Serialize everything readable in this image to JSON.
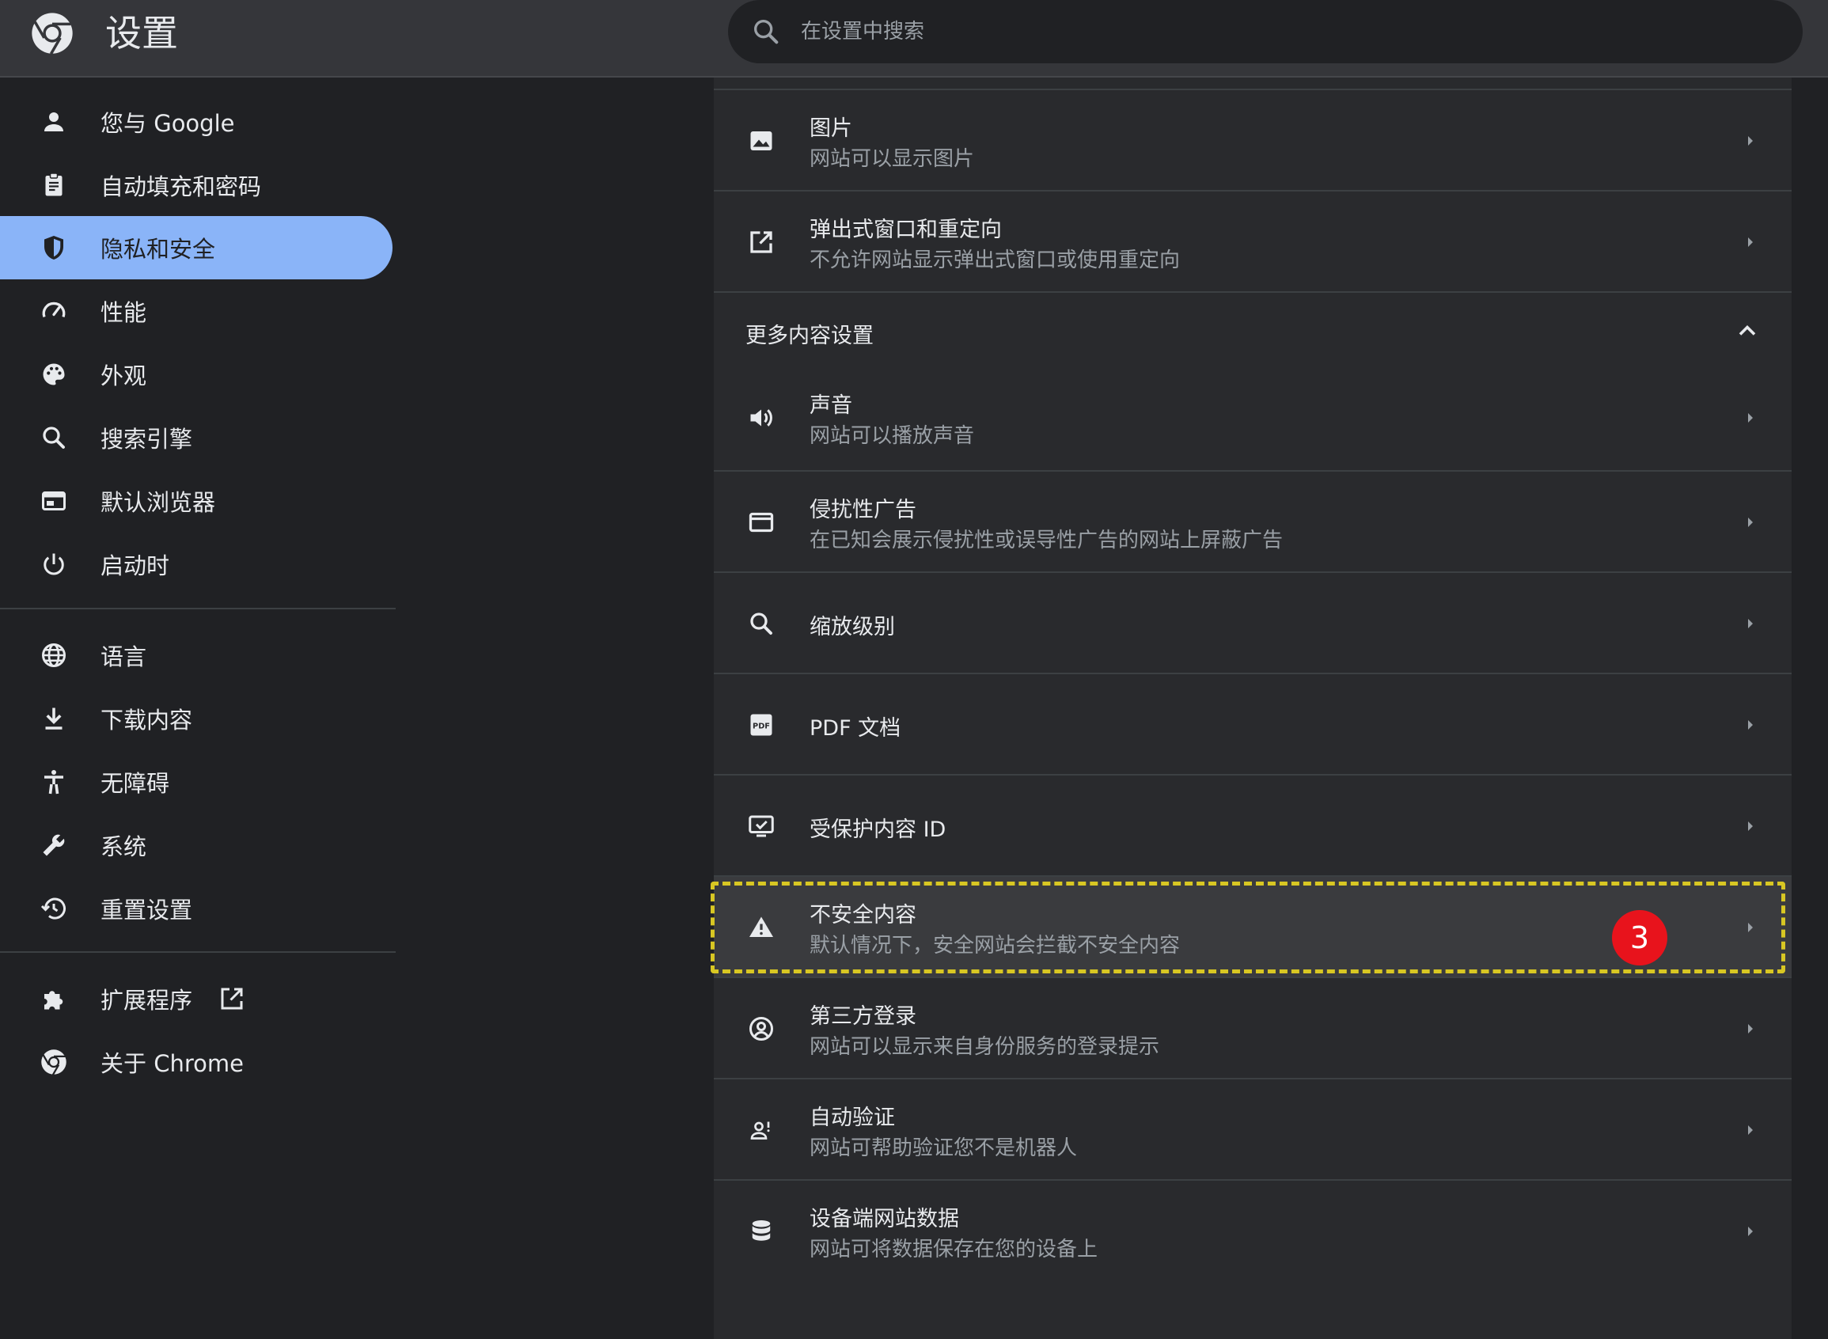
{
  "header": {
    "title": "设置",
    "search_placeholder": "在设置中搜索",
    "icons": {
      "logo": "chrome-logo-icon",
      "search": "search-icon"
    }
  },
  "sidebar": {
    "items": [
      {
        "label": "您与 Google",
        "icon": "person-icon",
        "active": false
      },
      {
        "label": "自动填充和密码",
        "icon": "clipboard-icon",
        "active": false
      },
      {
        "label": "隐私和安全",
        "icon": "shield-icon",
        "active": true
      },
      {
        "label": "性能",
        "icon": "speedometer-icon",
        "active": false
      },
      {
        "label": "外观",
        "icon": "palette-icon",
        "active": false
      },
      {
        "label": "搜索引擎",
        "icon": "search-icon",
        "active": false
      },
      {
        "label": "默认浏览器",
        "icon": "browser-icon",
        "active": false
      },
      {
        "label": "启动时",
        "icon": "power-icon",
        "active": false
      },
      {
        "label": "语言",
        "icon": "globe-icon",
        "active": false
      },
      {
        "label": "下载内容",
        "icon": "download-icon",
        "active": false
      },
      {
        "label": "无障碍",
        "icon": "accessibility-icon",
        "active": false
      },
      {
        "label": "系统",
        "icon": "wrench-icon",
        "active": false
      },
      {
        "label": "重置设置",
        "icon": "history-icon",
        "active": false
      },
      {
        "label": "扩展程序",
        "icon": "puzzle-icon",
        "active": false,
        "external": "external-link-icon"
      },
      {
        "label": "关于 Chrome",
        "icon": "chrome-logo-icon",
        "active": false
      }
    ]
  },
  "content": {
    "rows_top": [
      {
        "title": "图片",
        "subtitle": "网站可以显示图片",
        "icon": "image-icon"
      },
      {
        "title": "弹出式窗口和重定向",
        "subtitle": "不允许网站显示弹出式窗口或使用重定向",
        "icon": "open-in-new-icon"
      }
    ],
    "section_title": "更多内容设置",
    "rows": [
      {
        "title": "声音",
        "subtitle": "网站可以播放声音",
        "icon": "volume-icon"
      },
      {
        "title": "侵扰性广告",
        "subtitle": "在已知会展示侵扰性或误导性广告的网站上屏蔽广告",
        "icon": "window-icon"
      },
      {
        "title": "缩放级别",
        "subtitle": "",
        "icon": "zoom-icon"
      },
      {
        "title": "PDF 文档",
        "subtitle": "",
        "icon": "pdf-icon"
      },
      {
        "title": "受保护内容 ID",
        "subtitle": "",
        "icon": "monitor-check-icon"
      },
      {
        "title": "不安全内容",
        "subtitle": "默认情况下，安全网站会拦截不安全内容",
        "icon": "warning-icon",
        "badge": "3",
        "highlighted": true
      },
      {
        "title": "第三方登录",
        "subtitle": "网站可以显示来自身份服务的登录提示",
        "icon": "account-circle-icon"
      },
      {
        "title": "自动验证",
        "subtitle": "网站可帮助验证您不是机器人",
        "icon": "person-verify-icon"
      },
      {
        "title": "设备端网站数据",
        "subtitle": "网站可将数据保存在您的设备上",
        "icon": "database-icon"
      }
    ]
  },
  "colors": {
    "accent": "#8ab4f8",
    "background": "#202124",
    "header": "#35363a",
    "card": "#292a2d",
    "badge": "#e8131c",
    "highlight_border": "#d8c723"
  }
}
